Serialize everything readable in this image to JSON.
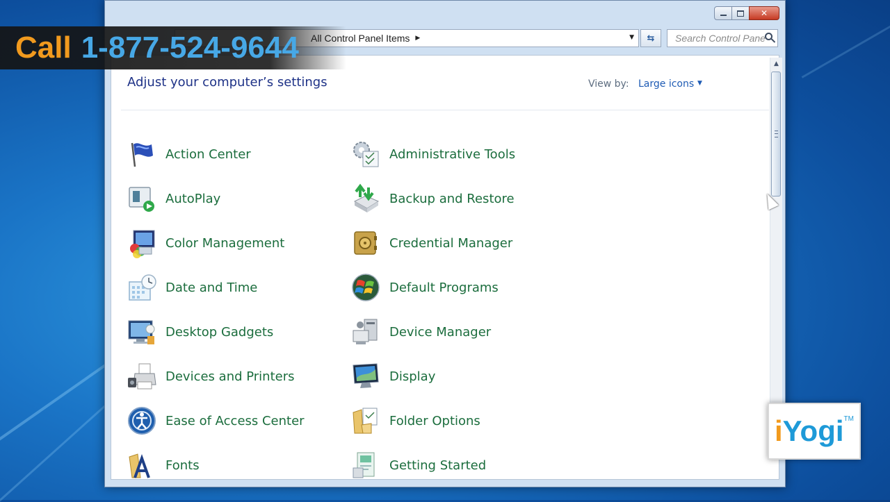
{
  "banner": {
    "call": "Call",
    "phone": "1-877-524-9644"
  },
  "address_bar": {
    "breadcrumb": "All Control Panel Items"
  },
  "search": {
    "placeholder": "Search Control Panel"
  },
  "content": {
    "heading": "Adjust your computer’s settings",
    "view_by_label": "View by:",
    "view_by_value": "Large icons"
  },
  "items": [
    {
      "label": "Action Center",
      "icon": "flag-icon"
    },
    {
      "label": "Administrative Tools",
      "icon": "admin-tools-icon"
    },
    {
      "label": "AutoPlay",
      "icon": "autoplay-icon"
    },
    {
      "label": "Backup and Restore",
      "icon": "backup-icon"
    },
    {
      "label": "Color Management",
      "icon": "color-management-icon"
    },
    {
      "label": "Credential Manager",
      "icon": "vault-icon"
    },
    {
      "label": "Date and Time",
      "icon": "calendar-clock-icon"
    },
    {
      "label": "Default Programs",
      "icon": "windows-orb-icon"
    },
    {
      "label": "Desktop Gadgets",
      "icon": "gadgets-icon"
    },
    {
      "label": "Device Manager",
      "icon": "device-manager-icon"
    },
    {
      "label": "Devices and Printers",
      "icon": "printer-icon"
    },
    {
      "label": "Display",
      "icon": "display-icon"
    },
    {
      "label": "Ease of Access Center",
      "icon": "ease-of-access-icon"
    },
    {
      "label": "Folder Options",
      "icon": "folder-options-icon"
    },
    {
      "label": "Fonts",
      "icon": "fonts-icon"
    },
    {
      "label": "Getting Started",
      "icon": "getting-started-icon"
    }
  ],
  "logo": {
    "i": "i",
    "yogi": "Yogi",
    "tm": "TM"
  },
  "colors": {
    "link_green": "#1b6d3d",
    "heading_blue": "#1e3287",
    "banner_orange": "#f19a1e",
    "banner_blue": "#47a8e6"
  }
}
